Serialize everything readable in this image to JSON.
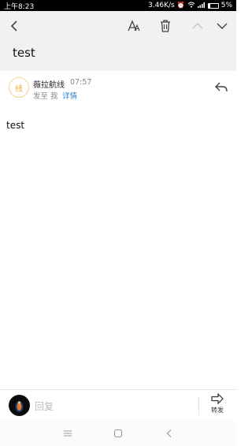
{
  "status_bar": {
    "time": "上午8:23",
    "speed": "3.46K/s",
    "battery": "5%"
  },
  "email": {
    "subject": "test",
    "sender_name": "薇拉航线",
    "sender_avatar_text": "线",
    "time": "07:57",
    "sent_to": "发至 我",
    "details": "详情",
    "body": "test"
  },
  "reply_bar": {
    "placeholder": "回复",
    "forward_label": "转发"
  },
  "colors": {
    "link": "#2e7fd8",
    "toolbar_bg": "#f1f1f3",
    "avatar_accent": "#e3b13a"
  },
  "icons": [
    "back-arrow-icon",
    "font-size-icon",
    "trash-icon",
    "chevron-up-icon",
    "chevron-down-icon",
    "reply-icon",
    "forward-icon",
    "menu-icon",
    "home-icon",
    "nav-back-icon"
  ]
}
